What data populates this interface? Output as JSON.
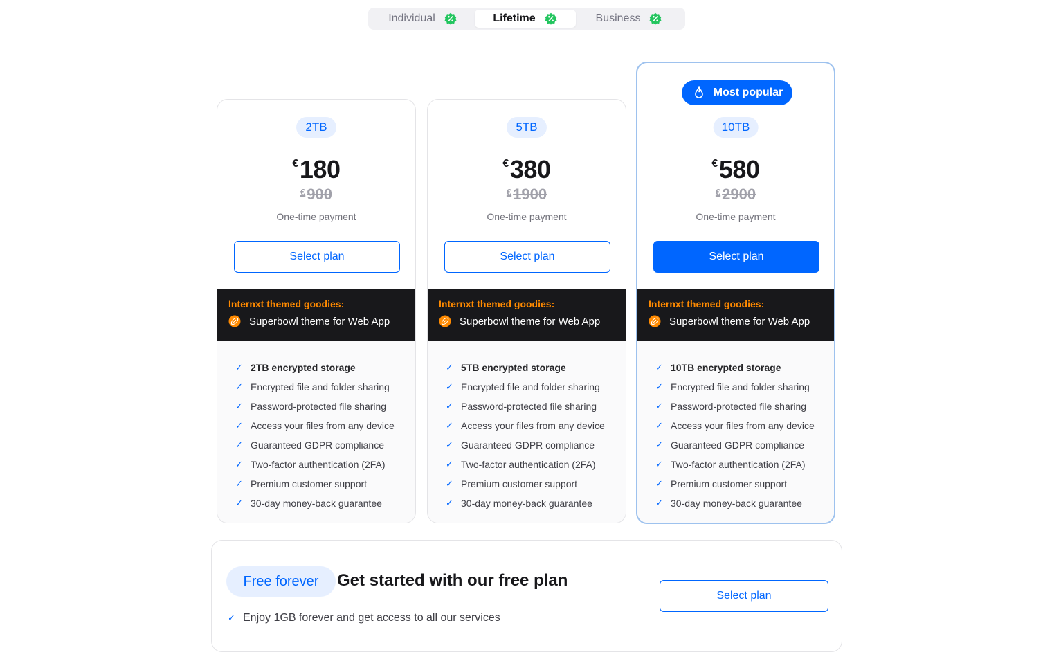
{
  "tabs": [
    {
      "label": "Individual",
      "icon": "percent-badge-icon",
      "active": false
    },
    {
      "label": "Lifetime",
      "icon": "percent-badge-icon",
      "active": true
    },
    {
      "label": "Business",
      "icon": "percent-badge-icon",
      "active": false
    }
  ],
  "colors": {
    "accent": "#0066ff",
    "badge_green": "#22c55e",
    "goodies_title": "#ff8a00",
    "goodies_bg": "#18181b"
  },
  "plans": [
    {
      "size": "2TB",
      "currency": "€",
      "price": "180",
      "old_price": "900",
      "payment": "One-time payment",
      "button": "Select plan",
      "goodies_title": "Internxt themed goodies:",
      "goodies_item": "Superbowl theme for Web App",
      "features": [
        "2TB encrypted storage",
        "Encrypted file and folder sharing",
        "Password-protected file sharing",
        "Access your files from any device",
        "Guaranteed GDPR compliance",
        "Two-factor authentication (2FA)",
        "Premium customer support",
        "30-day money-back guarantee"
      ]
    },
    {
      "size": "5TB",
      "currency": "€",
      "price": "380",
      "old_price": "1900",
      "payment": "One-time payment",
      "button": "Select plan",
      "goodies_title": "Internxt themed goodies:",
      "goodies_item": "Superbowl theme for Web App",
      "features": [
        "5TB encrypted storage",
        "Encrypted file and folder sharing",
        "Password-protected file sharing",
        "Access your files from any device",
        "Guaranteed GDPR compliance",
        "Two-factor authentication (2FA)",
        "Premium customer support",
        "30-day money-back guarantee"
      ]
    },
    {
      "badge": "Most popular",
      "size": "10TB",
      "currency": "€",
      "price": "580",
      "old_price": "2900",
      "payment": "One-time payment",
      "button": "Select plan",
      "goodies_title": "Internxt themed goodies:",
      "goodies_item": "Superbowl theme for Web App",
      "features": [
        "10TB encrypted storage",
        "Encrypted file and folder sharing",
        "Password-protected file sharing",
        "Access your files from any device",
        "Guaranteed GDPR compliance",
        "Two-factor authentication (2FA)",
        "Premium customer support",
        "30-day money-back guarantee"
      ]
    }
  ],
  "free_plan": {
    "chip": "Free forever",
    "title": "Get started with our free plan",
    "feature": "Enjoy 1GB forever and get access to all our services",
    "button": "Select plan"
  }
}
